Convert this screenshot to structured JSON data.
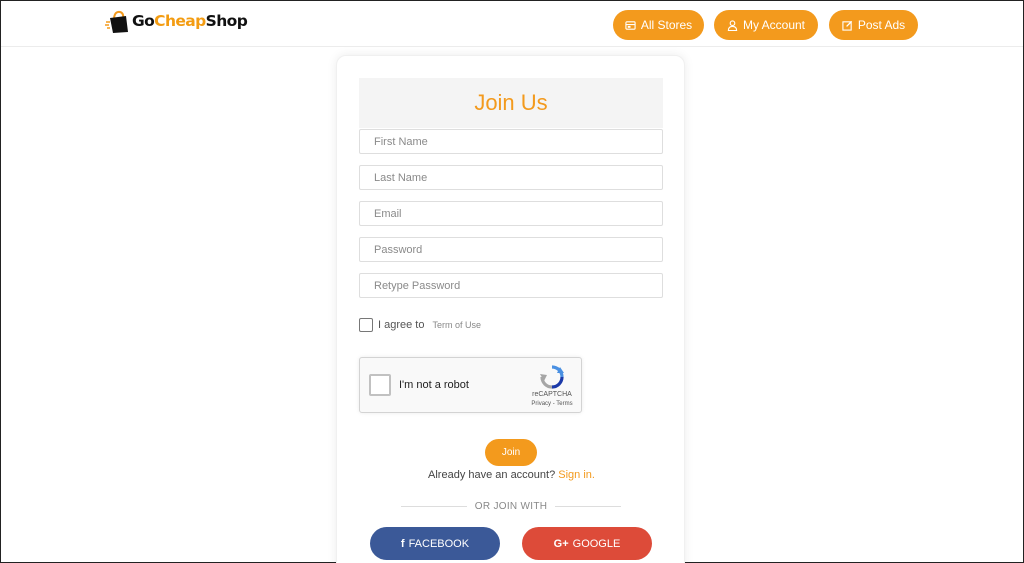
{
  "header": {
    "logo": {
      "part1": "Go",
      "part2": "Cheap",
      "part3": "Shop"
    },
    "nav": {
      "all_stores": "All Stores",
      "my_account": "My Account",
      "post_ads": "Post Ads"
    }
  },
  "form": {
    "title": "Join Us",
    "fields": {
      "first_name": {
        "placeholder": "First Name",
        "value": ""
      },
      "last_name": {
        "placeholder": "Last Name",
        "value": ""
      },
      "email": {
        "placeholder": "Email",
        "value": ""
      },
      "password": {
        "placeholder": "Password",
        "value": ""
      },
      "retype_password": {
        "placeholder": "Retype Password",
        "value": ""
      }
    },
    "agree": {
      "label": "I agree to",
      "link": "Term of Use",
      "checked": false
    },
    "recaptcha": {
      "label": "I'm not a robot",
      "brand": "reCAPTCHA",
      "terms": "Privacy - Terms"
    },
    "join_label": "Join",
    "signin": {
      "text": "Already have an account?",
      "link": "Sign in."
    },
    "divider": "OR JOIN WITH",
    "social": {
      "facebook": {
        "icon": "f",
        "label": "FACEBOOK"
      },
      "google": {
        "icon": "G+",
        "label": "GOOGLE"
      }
    }
  },
  "colors": {
    "accent": "#f39a1d",
    "facebook": "#3b5998",
    "google": "#dd4b39"
  },
  "icons": {
    "all_stores": "store-icon",
    "my_account": "user-icon",
    "post_ads": "edit-icon",
    "logo": "shopping-bag-icon"
  }
}
